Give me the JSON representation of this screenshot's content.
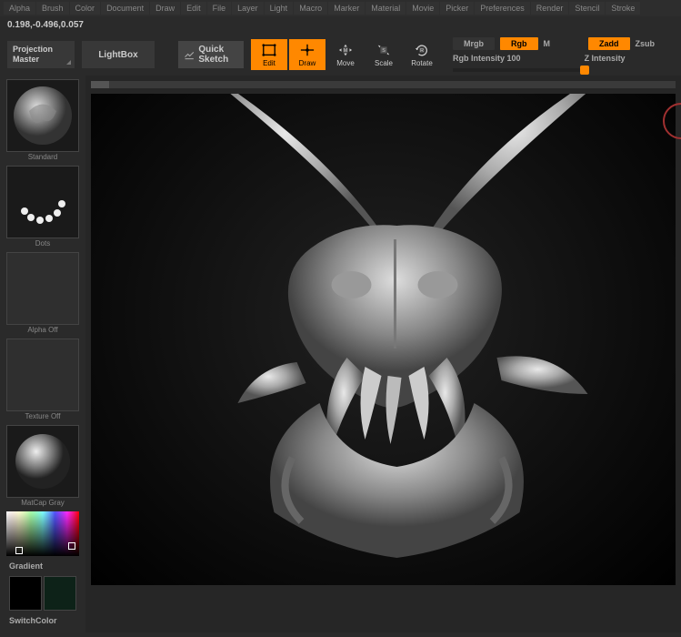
{
  "menu": [
    "Alpha",
    "Brush",
    "Color",
    "Document",
    "Draw",
    "Edit",
    "File",
    "Layer",
    "Light",
    "Macro",
    "Marker",
    "Material",
    "Movie",
    "Picker",
    "Preferences",
    "Render",
    "Stencil",
    "Stroke"
  ],
  "status": "0.198,-0.496,0.057",
  "toolbar": {
    "projection": "Projection Master",
    "lightbox": "LightBox",
    "quicksketch": "Quick Sketch",
    "modes": [
      {
        "label": "Edit",
        "active": true
      },
      {
        "label": "Draw",
        "active": true
      },
      {
        "label": "Move",
        "active": false
      },
      {
        "label": "Scale",
        "active": false
      },
      {
        "label": "Rotate",
        "active": false
      }
    ],
    "mrgb": "Mrgb",
    "rgb": "Rgb",
    "m": "M",
    "rgb_intensity_label": "Rgb Intensity",
    "rgb_intensity": "100",
    "zadd": "Zadd",
    "zsub": "Zsub",
    "z_intensity_label": "Z Intensity"
  },
  "sidebar": {
    "brush": "Standard",
    "stroke": "Dots",
    "alpha": "Alpha Off",
    "texture": "Texture Off",
    "material": "MatCap Gray",
    "gradient": "Gradient",
    "switchcolor": "SwitchColor",
    "swatch1": "#000000",
    "swatch2": "#0d2218"
  }
}
